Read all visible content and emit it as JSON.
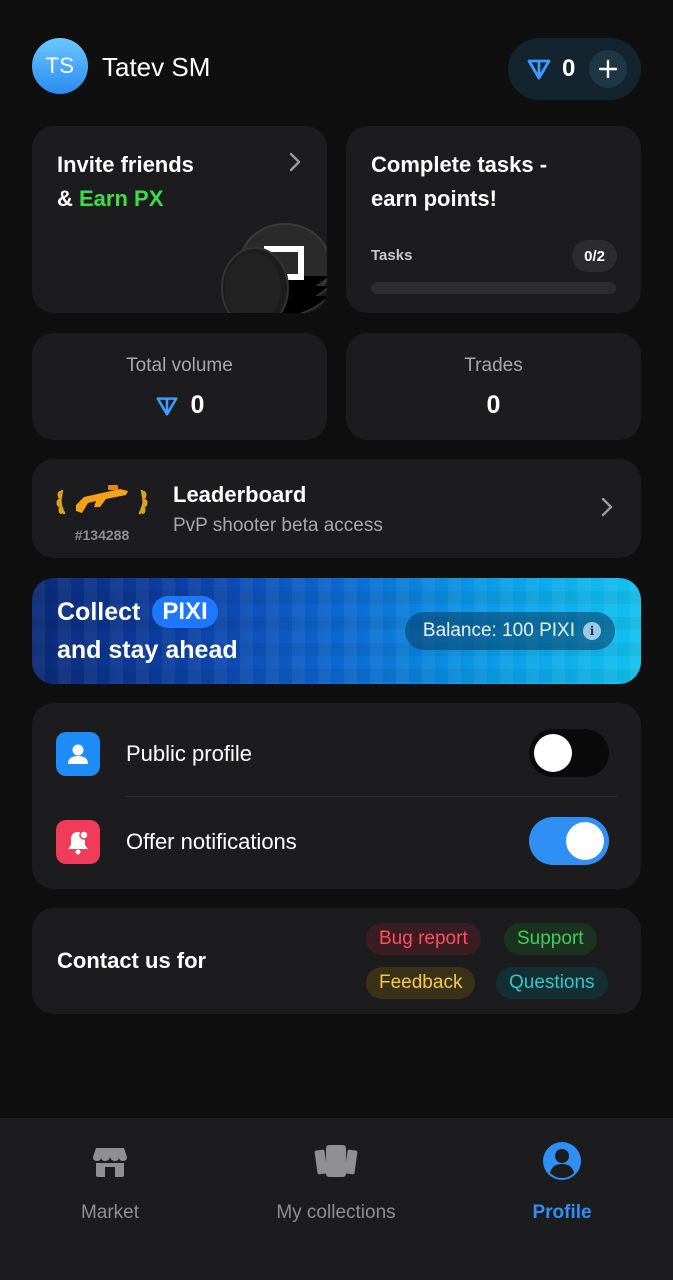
{
  "user": {
    "initials": "TS",
    "name": "Tatev SM",
    "balance": "0"
  },
  "colors": {
    "accent": "#2f8ff5",
    "green": "#3ddc4a",
    "toggle_on": "#2f8ff5"
  },
  "invite": {
    "line1": "Invite friends",
    "prefix": "& ",
    "highlight": "Earn PX"
  },
  "tasks": {
    "line1": "Complete tasks -",
    "line2": "earn points!",
    "label": "Tasks",
    "count": "0/2",
    "progress": 0
  },
  "stats": {
    "volume": {
      "label": "Total volume",
      "value": "0"
    },
    "trades": {
      "label": "Trades",
      "value": "0"
    }
  },
  "leaderboard": {
    "rank": "#134288",
    "title": "Leaderboard",
    "subtitle": "PvP shooter beta access"
  },
  "banner": {
    "collect": "Collect",
    "tag": "PIXI",
    "line2": "and stay ahead",
    "balance": "Balance: 100 PIXI",
    "info_icon": "i"
  },
  "settings": {
    "public_profile": {
      "label": "Public profile",
      "enabled": false
    },
    "offer_notifications": {
      "label": "Offer notifications",
      "enabled": true
    }
  },
  "contact": {
    "label": "Contact us for",
    "chips": [
      "Bug report",
      "Support",
      "Feedback",
      "Questions"
    ]
  },
  "nav": {
    "items": [
      {
        "label": "Market",
        "icon": "store-icon"
      },
      {
        "label": "My collections",
        "icon": "collections-icon"
      },
      {
        "label": "Profile",
        "icon": "profile-icon",
        "active": true
      }
    ]
  }
}
